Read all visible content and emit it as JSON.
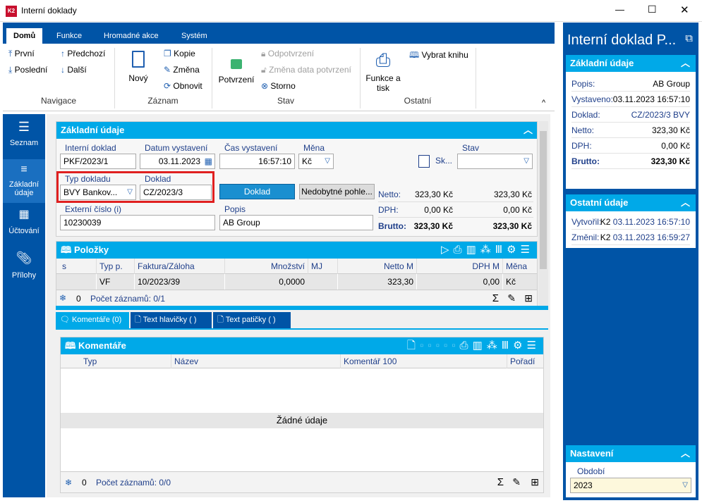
{
  "window": {
    "title": "Interní doklady",
    "min": "—",
    "max": "☐",
    "close": "✕"
  },
  "ribbon": {
    "tabs": [
      "Domů",
      "Funkce",
      "Hromadné akce",
      "Systém"
    ],
    "nav": {
      "first": "První",
      "last": "Poslední",
      "prev": "Předchozí",
      "next": "Další",
      "group": "Navigace"
    },
    "record": {
      "new": "Nový",
      "copy": "Kopie",
      "edit": "Změna",
      "refresh": "Obnovit",
      "group": "Záznam"
    },
    "state": {
      "confirm": "Potvrzení",
      "unconfirm": "Odpotvrzení",
      "change_date": "Změna data potvrzení",
      "cancel": "Storno",
      "group": "Stav"
    },
    "other": {
      "print": "Funkce a tisk",
      "book": "Vybrat knihu",
      "group": "Ostatní"
    }
  },
  "leftnav": [
    {
      "label": "Seznam",
      "icon": "menu-icon"
    },
    {
      "label": "Základní údaje",
      "icon": "list-icon"
    },
    {
      "label": "Účtování",
      "icon": "calculator-icon"
    },
    {
      "label": "Přílohy",
      "icon": "paperclip-icon"
    }
  ],
  "basic": {
    "title": "Základní údaje",
    "internal_doc": {
      "label": "Interní doklad",
      "value": "PKF/2023/1"
    },
    "date": {
      "label": "Datum vystavení",
      "value": "03.11.2023"
    },
    "time": {
      "label": "Čas vystavení",
      "value": "16:57:10"
    },
    "currency": {
      "label": "Měna",
      "value": "Kč"
    },
    "sk": {
      "label": "Sk..."
    },
    "state": {
      "label": "Stav",
      "value": ""
    },
    "doc_type": {
      "label": "Typ dokladu",
      "value": "BVY Bankov..."
    },
    "doc": {
      "label": "Doklad",
      "value": "CZ/2023/3"
    },
    "doc_button": "Doklad",
    "bad_debt_button": "Nedobytné pohle...",
    "external": {
      "label": "Externí číslo (i)",
      "value": "10230039"
    },
    "desc": {
      "label": "Popis",
      "value": "AB Group"
    },
    "totals": [
      {
        "label": "Netto:",
        "v1": "323,30 Kč",
        "v2": "323,30 Kč"
      },
      {
        "label": "DPH:",
        "v1": "0,00 Kč",
        "v2": "0,00 Kč"
      },
      {
        "label": "Brutto:",
        "v1": "323,30 Kč",
        "v2": "323,30 Kč"
      }
    ]
  },
  "items": {
    "title": "Položky",
    "columns": [
      "s",
      "",
      "Typ p.",
      "Faktura/Záloha",
      "Množství",
      "MJ",
      "Netto M",
      "DPH M",
      "Měna"
    ],
    "rows": [
      [
        "",
        "",
        "VF",
        "10/2023/39",
        "0,0000",
        "",
        "323,30",
        "0,00",
        "Kč"
      ]
    ],
    "footer_count": "0",
    "footer_text": "Počet záznamů: 0/1"
  },
  "tabs": [
    "Komentáře (0)",
    "Text hlavičky ( )",
    "Text patičky ( )"
  ],
  "comments": {
    "title": "Komentáře",
    "columns": [
      "Typ",
      "Název",
      "Komentář 100",
      "Pořadí"
    ],
    "empty": "Žádné údaje",
    "footer_count": "0",
    "footer_text": "Počet záznamů: 0/0"
  },
  "right": {
    "title": "Interní doklad P...",
    "basic_title": "Základní údaje",
    "basic": [
      {
        "k": "Popis:",
        "v": "AB Group"
      },
      {
        "k": "Vystaveno:",
        "v": "03.11.2023 16:57:10"
      },
      {
        "k": "Doklad:",
        "v": "CZ/2023/3 BVY"
      },
      {
        "k": "Netto:",
        "v": "323,30 Kč"
      },
      {
        "k": "DPH:",
        "v": "0,00 Kč"
      },
      {
        "k": "Brutto:",
        "v": "323,30 Kč"
      }
    ],
    "other_title": "Ostatní údaje",
    "other": [
      {
        "k": "Vytvořil:",
        "u": "K2",
        "v": "03.11.2023 16:57:10"
      },
      {
        "k": "Změnil:",
        "u": "K2",
        "v": "03.11.2023 16:59:27"
      }
    ],
    "settings_title": "Nastavení",
    "period_label": "Období",
    "period_value": "2023"
  },
  "colors": {
    "ribbon_blue": "#0054a6",
    "section_cyan": "#00a9e8",
    "highlight_red": "#e02020",
    "lock_green": "#3cb371"
  }
}
